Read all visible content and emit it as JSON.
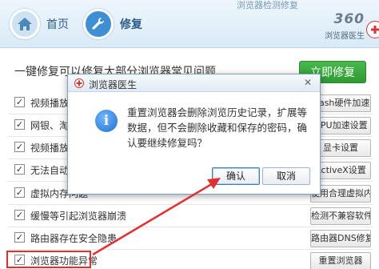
{
  "top": {
    "link": "浏览器检测修复",
    "tabs": [
      {
        "label": "首页"
      },
      {
        "label": "修复"
      }
    ],
    "brand_num": "360",
    "brand_name": "浏览器医生"
  },
  "main": {
    "headline": "一键修复可以修复大部分浏览器常见问题",
    "repair_button": "立即修复",
    "rows": [
      {
        "label": "视频播放有",
        "checked": true,
        "button": "Flash硬件加速"
      },
      {
        "label": "网银、淘宝",
        "checked": true,
        "button": "GPU加速设置"
      },
      {
        "label": "视频播放有",
        "checked": true,
        "button": "显卡设置"
      },
      {
        "label": "无法自动安",
        "checked": true,
        "button": "ActiveX设置"
      },
      {
        "label": "虚拟内存问题",
        "checked": true,
        "button": "使用合理虚拟内存"
      },
      {
        "label": "缓慢等引起浏览器崩溃",
        "checked": true,
        "button": "检测不兼容软件"
      },
      {
        "label": "路由器存在安全隐患",
        "checked": true,
        "button": "路由器DNS修复"
      },
      {
        "label": "浏览器功能异常",
        "checked": true,
        "button": "重置浏览器"
      }
    ]
  },
  "dialog": {
    "title": "浏览器医生",
    "close": "✕",
    "message": "重置浏览器会删除浏览历史记录，扩展等数据，但不会删除收藏和保存的密码，确认要继续修复吗？",
    "ok": "确认",
    "cancel": "取消"
  },
  "colors": {
    "accent": "#3f8fd5",
    "primary_green": "#2e9a33",
    "highlight_red": "#e23030"
  }
}
